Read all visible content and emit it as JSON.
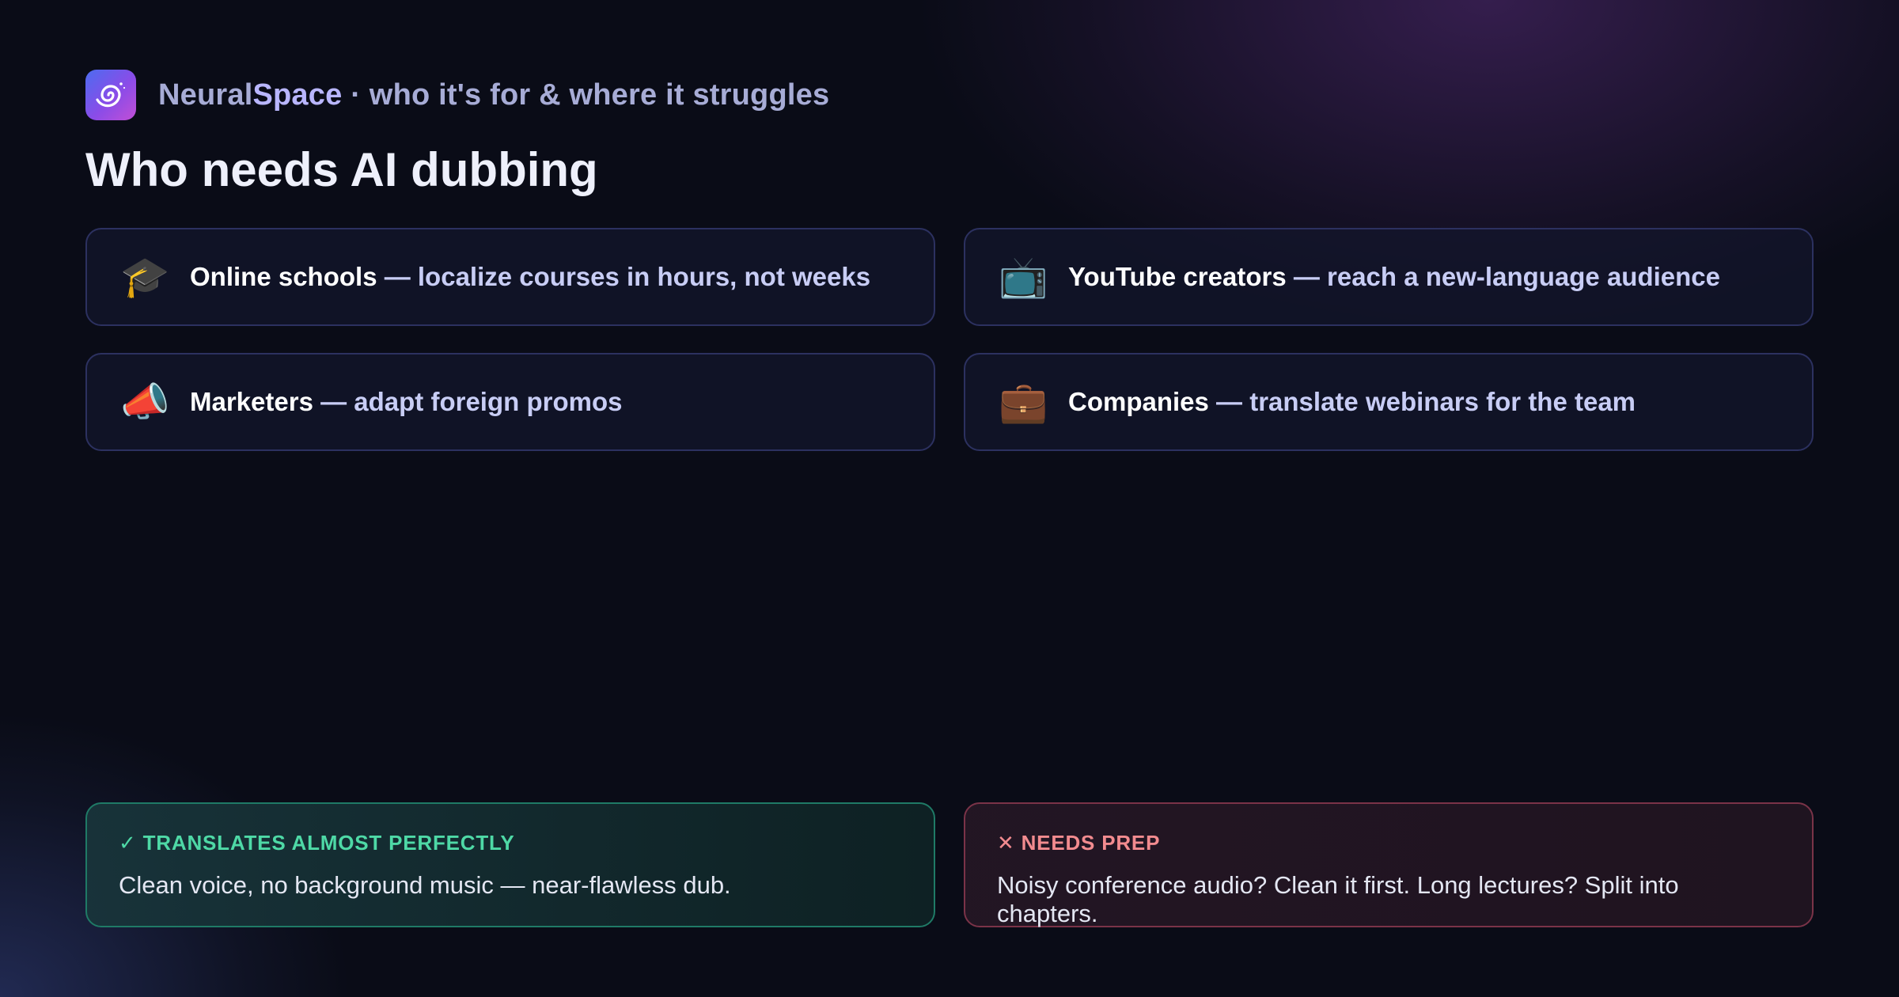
{
  "brand": {
    "name_part1": "Neural",
    "name_part2": "Space",
    "tagline": " · who it's for & where it struggles",
    "icon": "galaxy-swirl-icon"
  },
  "title": "Who needs AI dubbing",
  "audiences": [
    {
      "icon": "graduation-cap-icon",
      "emoji": "🎓",
      "name": "Online schools",
      "desc": " — localize courses in hours, not weeks"
    },
    {
      "icon": "television-icon",
      "emoji": "📺",
      "name": "YouTube creators",
      "desc": " — reach a new-language audience"
    },
    {
      "icon": "megaphone-icon",
      "emoji": "📣",
      "name": "Marketers",
      "desc": " — adapt foreign promos"
    },
    {
      "icon": "briefcase-icon",
      "emoji": "💼",
      "name": "Companies",
      "desc": " — translate webinars for the team"
    }
  ],
  "notes": {
    "good": {
      "label": "✓ TRANSLATES ALMOST PERFECTLY",
      "body": "Clean voice, no background music — near-flawless dub.",
      "color": "#4ed9a6"
    },
    "bad": {
      "label": "✕ NEEDS PREP",
      "body": "Noisy conference audio? Clean it first. Long lectures? Split into chapters.",
      "color": "#f28b8f"
    }
  }
}
